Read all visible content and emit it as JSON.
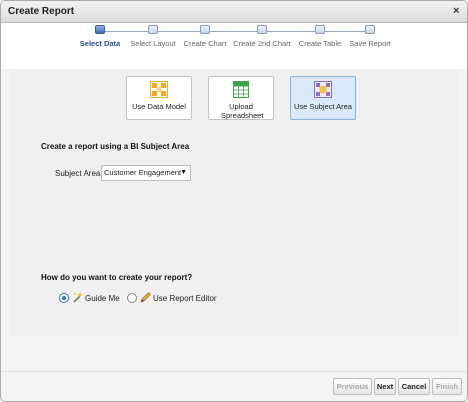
{
  "window": {
    "title": "Create Report",
    "close_glyph": "×"
  },
  "train": {
    "steps": [
      {
        "label": "Select Data",
        "active": true
      },
      {
        "label": "Select Layout",
        "active": false
      },
      {
        "label": "Create Chart",
        "active": false
      },
      {
        "label": "Create 2nd Chart",
        "active": false
      },
      {
        "label": "Create Table",
        "active": false
      },
      {
        "label": "Save Report",
        "active": false
      }
    ]
  },
  "sources": [
    {
      "label": "Use Data Model",
      "icon": "data-model-icon",
      "selected": false
    },
    {
      "label": "Upload Spreadsheet",
      "icon": "spreadsheet-icon",
      "selected": false
    },
    {
      "label": "Use Subject Area",
      "icon": "subject-area-icon",
      "selected": true
    }
  ],
  "bi_section": {
    "heading": "Create a report using a BI Subject Area",
    "subject_area_label": "Subject Area",
    "subject_area_value": "Customer Engagement",
    "caret": "▼"
  },
  "method_section": {
    "heading": "How do you want to create your report?",
    "options": [
      {
        "label": "Guide Me",
        "icon": "wand-icon",
        "checked": true
      },
      {
        "label": "Use Report Editor",
        "icon": "pencil-icon",
        "checked": false
      }
    ]
  },
  "buttons": {
    "previous": "Previous",
    "next": "Next",
    "cancel": "Cancel",
    "finish": "Finish"
  },
  "colors": {
    "accent": "#3f6db9",
    "selected_tile": "#dbeafa",
    "panel": "#f0f0f0",
    "data_model_orange": "#f5a623",
    "spreadsheet_green": "#3ea34a",
    "subject_area_purple": "#8a6fc9"
  }
}
